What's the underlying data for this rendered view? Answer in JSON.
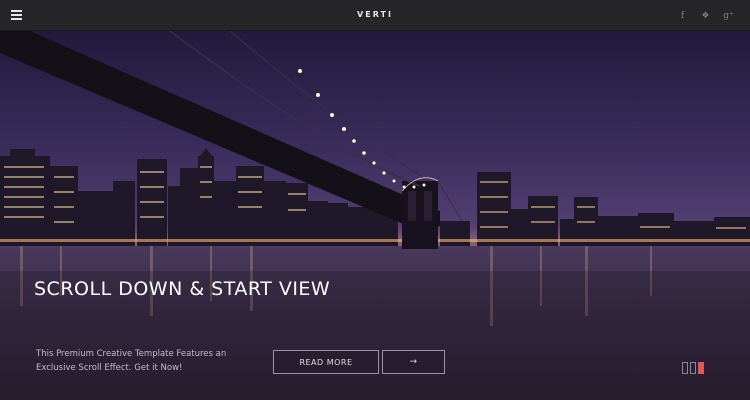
{
  "header": {
    "brand": "VERTI",
    "social": [
      {
        "icon": "facebook-icon",
        "glyph": "f"
      },
      {
        "icon": "dropbox-icon",
        "glyph": "❖"
      },
      {
        "icon": "google-plus-icon",
        "glyph": "g⁺"
      }
    ]
  },
  "hero": {
    "headline": "SCROLL DOWN & START VIEW",
    "subtext": "This Premium Creative Template Features an Exclusive Scroll Effect. Get it Now!",
    "read_more_label": "READ MORE",
    "arrow_label": "→",
    "pager": {
      "count": 3,
      "active_index": 2
    }
  },
  "colors": {
    "topbar": "#26262a",
    "sky_top": "#2a1f47",
    "sky_bottom": "#4a3a6e",
    "accent": "#e0585b"
  }
}
